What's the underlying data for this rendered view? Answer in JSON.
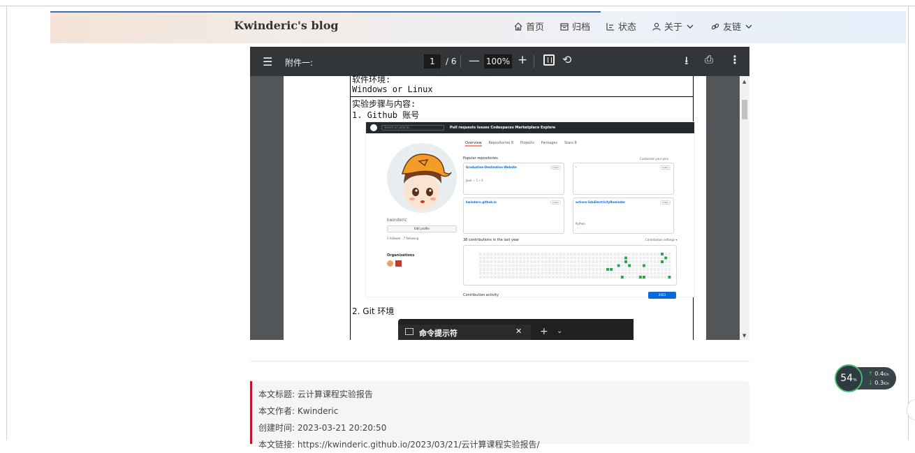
{
  "header": {
    "site_title": "Kwinderic's blog",
    "nav": [
      {
        "label": "首页",
        "icon": "home-icon"
      },
      {
        "label": "归档",
        "icon": "archive-icon"
      },
      {
        "label": "状态",
        "icon": "status-icon"
      },
      {
        "label": "关于",
        "icon": "user-icon",
        "dropdown": true
      },
      {
        "label": "友链",
        "icon": "link-icon",
        "dropdown": true
      }
    ]
  },
  "pdf": {
    "title": "附件一:",
    "page_current": "1",
    "page_total": "/ 6",
    "zoom": "100%",
    "doc_lines": {
      "env_heading": "软件环境:",
      "env_value": "Windows or Linux",
      "steps_heading": "实验步骤与内容:",
      "step1": "1. Github 账号",
      "step2": "2. Git 环境"
    },
    "github": {
      "search": "Search or jump to...",
      "links": "Pull requests   Issues   Codespaces   Marketplace   Explore",
      "tabs": [
        "Overview",
        "Repositories 8",
        "Projects",
        "Packages",
        "Stars 8"
      ],
      "username": "kwinderic",
      "edit_profile": "Edit profile",
      "followers": "1 follower · 7 following",
      "organizations": "Organizations",
      "popular": "Popular repositories",
      "customize": "Customize your pins",
      "repos": [
        {
          "name": "Graduation-Destination-Website",
          "visibility": "Public",
          "meta": "Java  ☆ 1  ⑂ 1"
        },
        {
          "name": "-",
          "visibility": "Public",
          "meta": ""
        },
        {
          "name": "kwinderic.github.io",
          "visibility": "Public",
          "meta": ""
        },
        {
          "name": "actions-SduElectricityReminder",
          "visibility": "Public",
          "meta": "Python"
        }
      ],
      "contributions": "38 contributions in the last year",
      "contribution_settings": "Contribution settings ▾",
      "activity": "Contribution activity",
      "year": "2023"
    },
    "terminal_tab": "命令提示符"
  },
  "copyright": {
    "title_label": "本文标题:",
    "title_value": "云计算课程实验报告",
    "author_label": "本文作者:",
    "author_value": "Kwinderic",
    "created_label": "创建时间:",
    "created_value": "2023-03-21 20:20:50",
    "link_label": "本文链接:",
    "link_value": "https://kwinderic.github.io/2023/03/21/云计算课程实验报告/"
  },
  "speed_widget": {
    "percent": "54",
    "percent_unit": "%",
    "up": "0.4",
    "down": "0.3",
    "unit": "K/s"
  },
  "colors": {
    "accent_red": "#c0143c",
    "nav_line": "#3b6fb0",
    "pdf_bg": "#525659",
    "pdf_toolbar": "#323639"
  }
}
